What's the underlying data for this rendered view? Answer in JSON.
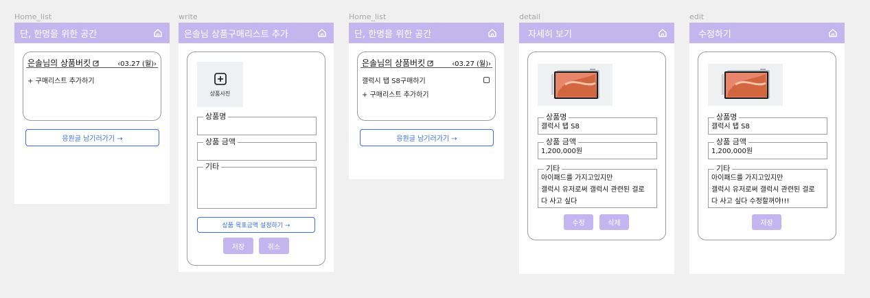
{
  "frames": {
    "home1": {
      "label": "Home_list",
      "header_title": "단, 한명을 위한 공간",
      "bucket_title": "은솔님의 상품버킷",
      "date": "‹03.27 (월)›",
      "add_item": "+ 구매리스트 추가하기",
      "cheer_button": "응원글 남기러가기  →"
    },
    "write": {
      "label": "write",
      "header_title": "은솔님 상품구매리스트 추가",
      "photo_label": "상품사진",
      "field_name": "상품명",
      "field_price": "상품 금액",
      "field_etc": "기타",
      "goal_button": "상품 목표금액 설정하기  →",
      "save": "저장",
      "cancel": "취소"
    },
    "home2": {
      "label": "Home_list",
      "header_title": "단, 한명을 위한 공간",
      "bucket_title": "은솔님의 상품버킷",
      "date": "‹03.27 (월)›",
      "item1": "갤럭시 탭 S8구매하기",
      "add_item": "+ 구매리스트 추가하기",
      "cheer_button": "응원글 남기러가기  →"
    },
    "detail": {
      "label": "detail",
      "header_title": "자세히 보기",
      "field_name": "상품명",
      "name_value": "갤럭시 탭 S8",
      "field_price": "상품 금액",
      "price_value": "1,200,000원",
      "field_etc": "기타",
      "etc_line1": "아이패드를 가지고있지만",
      "etc_line2": "갤럭시 유저로써 갤럭시 관련된 걸로",
      "etc_line3": "다 사고 싶다",
      "edit": "수정",
      "delete": "삭제"
    },
    "edit": {
      "label": "edit",
      "header_title": "수정하기",
      "field_name": "상품명",
      "name_value": "갤럭시 탭 S8",
      "field_price": "상품 금액",
      "price_value": "1,200,000원",
      "field_etc": "기타",
      "etc_line1": "아이패드를 가지고있지만",
      "etc_line2": "갤럭시 유저로써 갤럭시 관련된 걸로",
      "etc_line3": "다 사고 싶다 수정할꺼야!!!",
      "save": "저장"
    }
  },
  "icons": {
    "home": "home-icon",
    "edit": "edit-pencil-icon",
    "add": "plus-square-icon",
    "check": "checkbox-icon"
  },
  "colors": {
    "header": "#c4b5ef",
    "accent_blue": "#3a6fe0",
    "background": "#f0f0f0"
  }
}
